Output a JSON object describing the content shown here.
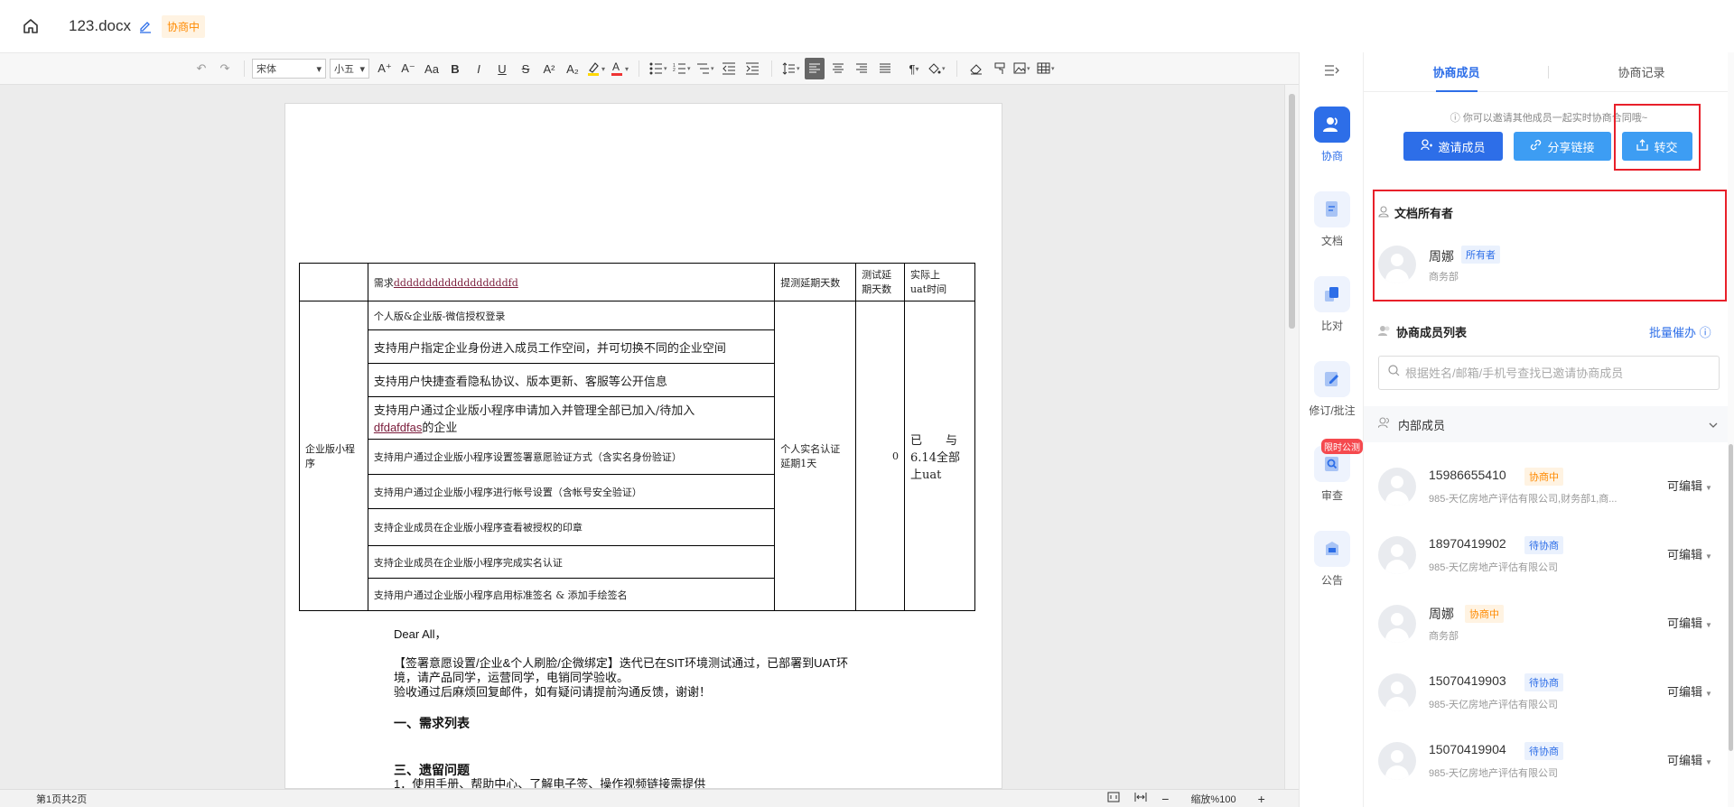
{
  "header": {
    "doc_title": "123.docx",
    "status": "协商中"
  },
  "toolbar": {
    "font_family": "宋体",
    "font_size": "小五",
    "font_grow": "A⁺",
    "font_shrink": "A⁻",
    "case": "Aa",
    "bold": "B",
    "italic": "I",
    "underline": "U",
    "strike": "S",
    "superscript": "A²",
    "subscript": "A₂",
    "paragraph_mark": "¶"
  },
  "document": {
    "table": {
      "header": {
        "req_prefix": "需求",
        "req_underlined": "ddddddddddddddddddfd",
        "delay_days": "提测延期天数",
        "test_delay": "测试延期天数",
        "uat_line1": "实际上",
        "uat_line2": "uat时间"
      },
      "category": "企业版小程序",
      "rows": [
        "个人版&企业版-微信授权登录",
        "支持用户指定企业身份进入成员工作空间，并可切换不同的企业空间",
        "支持用户快捷查看隐私协议、版本更新、客服等公开信息",
        "支持用户通过企业版小程序申请加入并管理全部已加入/待加入",
        "支持用户通过企业版小程序设置签署意愿验证方式（含实名身份验证）",
        "支持用户通过企业版小程序进行帐号设置（含帐号安全验证）",
        "支持企业成员在企业版小程序查看被授权的印章",
        "支持企业成员在企业版小程序完成实名认证",
        "支持用户通过企业版小程序启用标准签名 & 添加手绘签名"
      ],
      "row4_underlined": "dfdafdfas",
      "row4_suffix": "的企业",
      "delay_value": "个人实名认证延期1天",
      "test_value": "0",
      "uat_value_line1": "已　　与",
      "uat_value_line2": "6.14全部",
      "uat_value_line3": "上uat"
    },
    "greeting": "Dear All，",
    "para1": "【签署意愿设置/企业&个人刷脸/企微绑定】迭代已在SIT环境测试通过，已部署到UAT环",
    "para2": "境，请产品同学，运营同学，电销同学验收。",
    "para3": "验收通过后麻烦回复邮件，如有疑问请提前沟通反馈，谢谢！",
    "heading1": "一、需求列表",
    "heading3": "三、遗留问题",
    "cut_line": "1．使用手册、帮助中心、了解电子签、操作视频链接需提供"
  },
  "status_bar": {
    "page_info": "第1页共2页",
    "zoom": "缩放%100",
    "zoom_out": "−",
    "zoom_in": "+"
  },
  "rail": [
    {
      "label": "协商",
      "icon": "users-icon"
    },
    {
      "label": "文档",
      "icon": "document-icon"
    },
    {
      "label": "比对",
      "icon": "compare-icon"
    },
    {
      "label": "修订/批注",
      "icon": "revise-icon"
    },
    {
      "label": "审查",
      "icon": "review-icon",
      "badge": "限时公测"
    },
    {
      "label": "公告",
      "icon": "notice-icon"
    }
  ],
  "panel": {
    "tabs": [
      "协商成员",
      "协商记录"
    ],
    "tip": "你可以邀请其他成员一起实时协商合同哦~",
    "buttons": {
      "invite": "邀请成员",
      "share": "分享链接",
      "transfer": "转交"
    },
    "owner_section": {
      "title": "文档所有者",
      "name": "周娜",
      "tag": "所有者",
      "dept": "商务部"
    },
    "members_section": {
      "title": "协商成员列表",
      "batch_remind": "批量催办",
      "search_placeholder": "根据姓名/邮箱/手机号查找已邀请协商成员"
    },
    "group": "内部成员",
    "members": [
      {
        "name": "15986655410",
        "tag": "协商中",
        "tag_type": "orange",
        "dept": "985-天亿房地产评估有限公司,财务部1,商...",
        "perm": "可编辑"
      },
      {
        "name": "18970419902",
        "tag": "待协商",
        "tag_type": "blue",
        "dept": "985-天亿房地产评估有限公司",
        "perm": "可编辑"
      },
      {
        "name": "周娜",
        "tag": "协商中",
        "tag_type": "orange",
        "dept": "商务部",
        "perm": "可编辑"
      },
      {
        "name": "15070419903",
        "tag": "待协商",
        "tag_type": "blue",
        "dept": "985-天亿房地产评估有限公司",
        "perm": "可编辑"
      },
      {
        "name": "15070419904",
        "tag": "待协商",
        "tag_type": "blue",
        "dept": "985-天亿房地产评估有限公司",
        "perm": "可编辑"
      }
    ]
  },
  "colors": {
    "primary": "#2d6ee8",
    "light_blue": "#3d9df3",
    "highlight": "#e8202a",
    "orange": "#ff8a00"
  }
}
